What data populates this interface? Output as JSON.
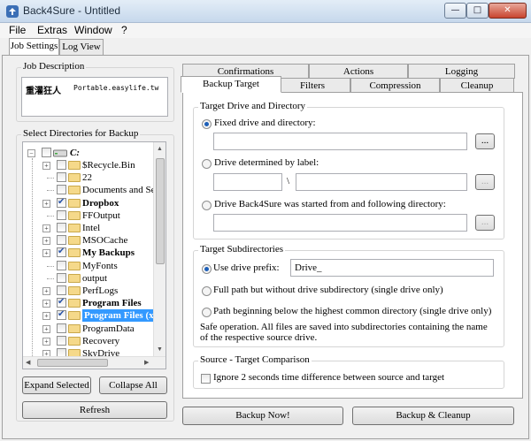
{
  "window": {
    "title": "Back4Sure - Untitled",
    "minimize": "—",
    "maximize": "□",
    "close": "✕"
  },
  "menu": [
    "File",
    "Extras",
    "Window",
    "?"
  ],
  "top_tabs": {
    "job_settings": "Job Settings",
    "log_view": "Log View"
  },
  "job_description": {
    "label": "Job Description",
    "logo_text": "重灌狂人",
    "logo_subtext": "Portable.easylife.tw"
  },
  "select_dirs": {
    "label": "Select Directories for Backup",
    "root": "C:",
    "items": [
      {
        "label": "$Recycle.Bin",
        "checked": false,
        "bold": false,
        "expandable": true
      },
      {
        "label": "22",
        "checked": false,
        "bold": false,
        "expandable": false
      },
      {
        "label": "Documents and Sett",
        "checked": false,
        "bold": false,
        "expandable": false
      },
      {
        "label": "Dropbox",
        "checked": true,
        "bold": true,
        "expandable": true
      },
      {
        "label": "FFOutput",
        "checked": false,
        "bold": false,
        "expandable": false
      },
      {
        "label": "Intel",
        "checked": false,
        "bold": false,
        "expandable": true
      },
      {
        "label": "MSOCache",
        "checked": false,
        "bold": false,
        "expandable": true
      },
      {
        "label": "My Backups",
        "checked": true,
        "bold": true,
        "expandable": true
      },
      {
        "label": "MyFonts",
        "checked": false,
        "bold": false,
        "expandable": false
      },
      {
        "label": "output",
        "checked": false,
        "bold": false,
        "expandable": false
      },
      {
        "label": "PerfLogs",
        "checked": false,
        "bold": false,
        "expandable": true
      },
      {
        "label": "Program Files",
        "checked": true,
        "bold": true,
        "expandable": true
      },
      {
        "label": "Program Files (x",
        "checked": true,
        "bold": true,
        "expandable": true,
        "selected": true
      },
      {
        "label": "ProgramData",
        "checked": false,
        "bold": false,
        "expandable": true
      },
      {
        "label": "Recovery",
        "checked": false,
        "bold": false,
        "expandable": true
      },
      {
        "label": "SkyDrive",
        "checked": false,
        "bold": false,
        "expandable": true
      }
    ]
  },
  "buttons": {
    "expand_selected": "Expand Selected",
    "collapse_all": "Collapse All",
    "refresh": "Refresh",
    "backup_now": "Backup Now!",
    "backup_cleanup": "Backup & Cleanup",
    "browse": "..."
  },
  "settings_tabs": {
    "row_back": [
      "Confirmations",
      "Actions",
      "Logging"
    ],
    "row_front": [
      "Backup Target",
      "Filters",
      "Compression",
      "Cleanup"
    ]
  },
  "target_drive": {
    "label": "Target Drive and Directory",
    "opt_fixed": "Fixed drive and directory:",
    "opt_label": "Drive determined by label:",
    "separator": "\\",
    "opt_started": "Drive Back4Sure was started from and following directory:"
  },
  "target_subdirs": {
    "label": "Target Subdirectories",
    "opt_prefix": "Use drive prefix:",
    "prefix_value": "Drive_",
    "opt_full": "Full path but without drive subdirectory (single drive only)",
    "opt_below": "Path beginning below the highest common directory (single drive only)",
    "note": "Safe operation. All files are saved into subdirectories containing the name of the respective source drive."
  },
  "comparison": {
    "label": "Source - Target Comparison",
    "ignore_2s": "Ignore 2 seconds time difference between source and target"
  }
}
